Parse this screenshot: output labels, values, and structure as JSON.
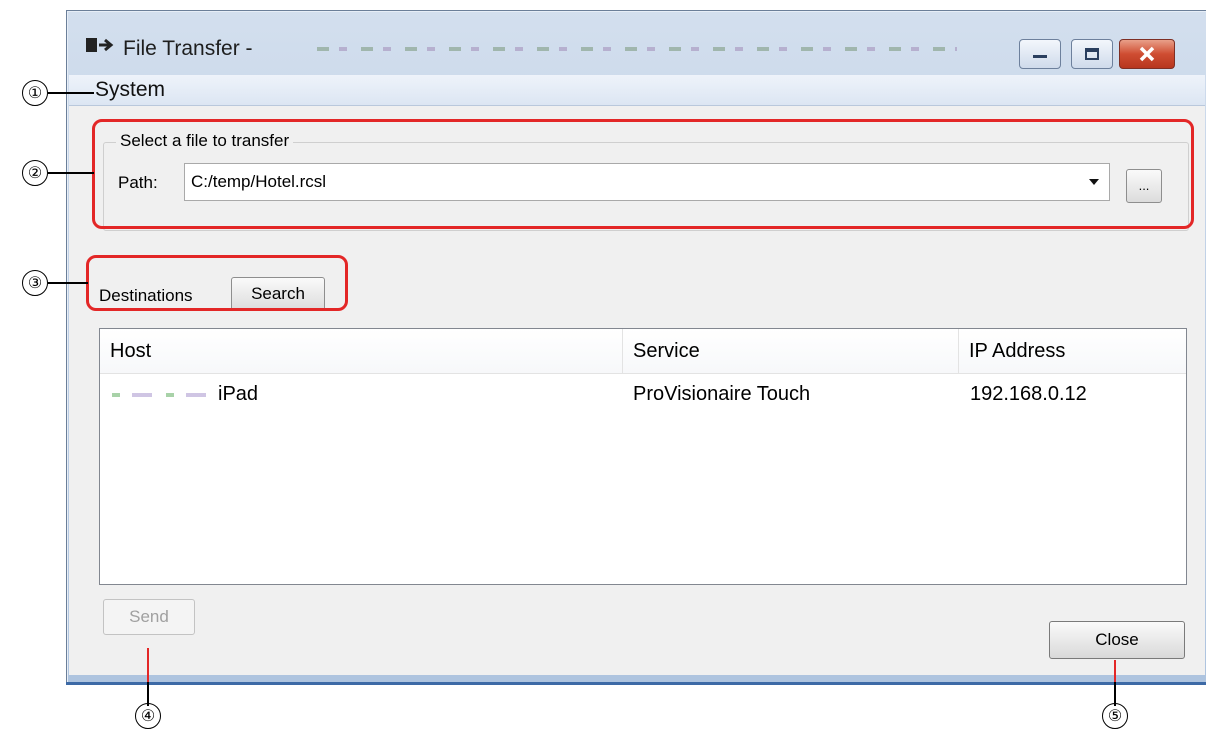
{
  "window": {
    "title": "File Transfer -",
    "colors": {
      "highlight": "#e32727",
      "close_button": "#cf4d32"
    }
  },
  "menu": {
    "items": [
      "System"
    ]
  },
  "file_group": {
    "legend": "Select a file to transfer",
    "path_label": "Path:",
    "path_value": "C:/temp/Hotel.rcsl",
    "browse_label": "..."
  },
  "destinations": {
    "label": "Destinations",
    "search_label": "Search",
    "columns": [
      "Host",
      "Service",
      "IP Address"
    ],
    "rows": [
      {
        "host": "iPad",
        "service": "ProVisionaire Touch",
        "ip": "192.168.0.12"
      }
    ]
  },
  "buttons": {
    "send": "Send",
    "close": "Close"
  },
  "callouts": [
    "①",
    "②",
    "③",
    "④",
    "⑤"
  ],
  "icons": [
    "transfer-icon",
    "minimize-icon",
    "maximize-icon",
    "close-icon",
    "dropdown-arrow-icon"
  ]
}
